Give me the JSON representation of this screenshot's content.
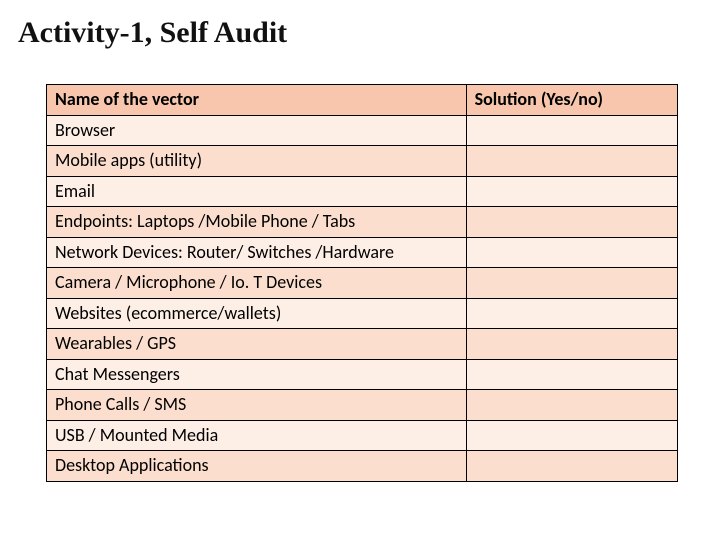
{
  "title": "Activity-1, Self Audit",
  "table": {
    "headers": {
      "name": "Name of the vector",
      "solution": "Solution (Yes/no)"
    },
    "rows": [
      {
        "name": "Browser",
        "solution": ""
      },
      {
        "name": "Mobile apps (utility)",
        "solution": ""
      },
      {
        "name": "Email",
        "solution": ""
      },
      {
        "name": "Endpoints: Laptops /Mobile Phone / Tabs",
        "solution": ""
      },
      {
        "name": "Network Devices: Router/ Switches /Hardware",
        "solution": ""
      },
      {
        "name": "Camera / Microphone / Io. T Devices",
        "solution": ""
      },
      {
        "name": "Websites (ecommerce/wallets)",
        "solution": ""
      },
      {
        "name": "Wearables / GPS",
        "solution": ""
      },
      {
        "name": "Chat Messengers",
        "solution": ""
      },
      {
        "name": "Phone Calls / SMS",
        "solution": ""
      },
      {
        "name": "USB / Mounted Media",
        "solution": ""
      },
      {
        "name": "Desktop Applications",
        "solution": ""
      }
    ]
  }
}
